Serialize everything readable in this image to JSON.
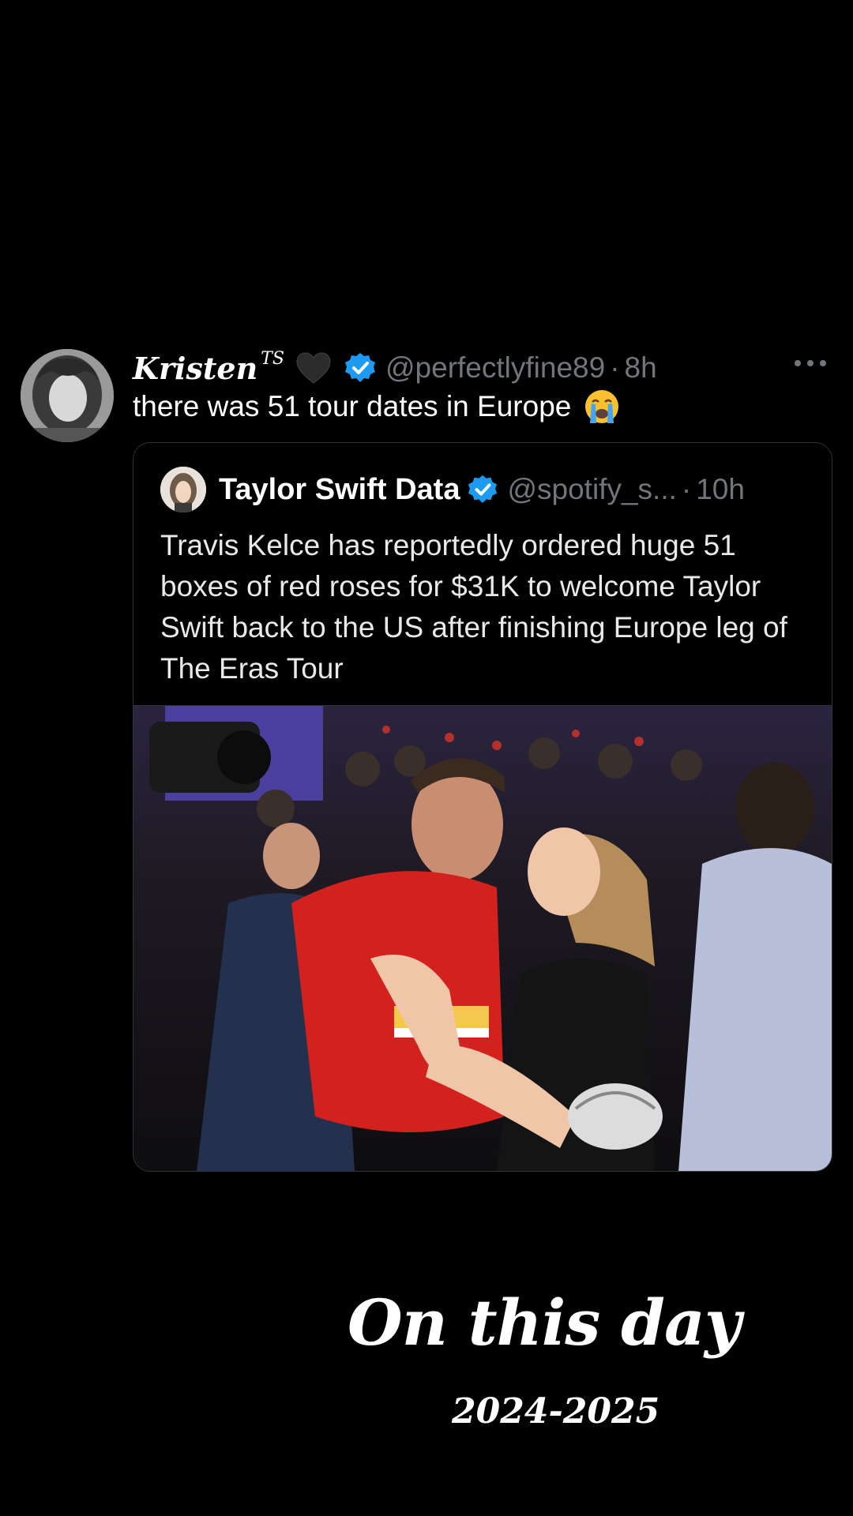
{
  "tweet": {
    "display_name": "Kristen",
    "name_superscript": "TS",
    "heart_emoji": "black-heart-emoji",
    "verified_icon": "verified-badge-icon",
    "handle": "@perfectlyfine89",
    "separator": "·",
    "time": "8h",
    "more_icon": "more-options-icon",
    "text": "there was 51 tour dates in Europe",
    "text_emoji": "loudly-crying-face-emoji",
    "avatar": "user-avatar"
  },
  "quote": {
    "display_name": "Taylor Swift Data",
    "verified_icon": "verified-badge-icon",
    "handle": "@spotify_s...",
    "separator": "·",
    "time": "10h",
    "text": "Travis Kelce has reportedly ordered huge 51 boxes of red roses for $31K to welcome Taylor Swift back to the US after finishing Europe leg of The Eras Tour",
    "image": "celebration-photo"
  },
  "overlay": {
    "title": "On this day",
    "years": "2024-2025"
  },
  "colors": {
    "background": "#000000",
    "text_primary": "#ffffff",
    "text_secondary": "#71767b",
    "verified_blue": "#1d9bf0",
    "border": "#2f3336"
  }
}
